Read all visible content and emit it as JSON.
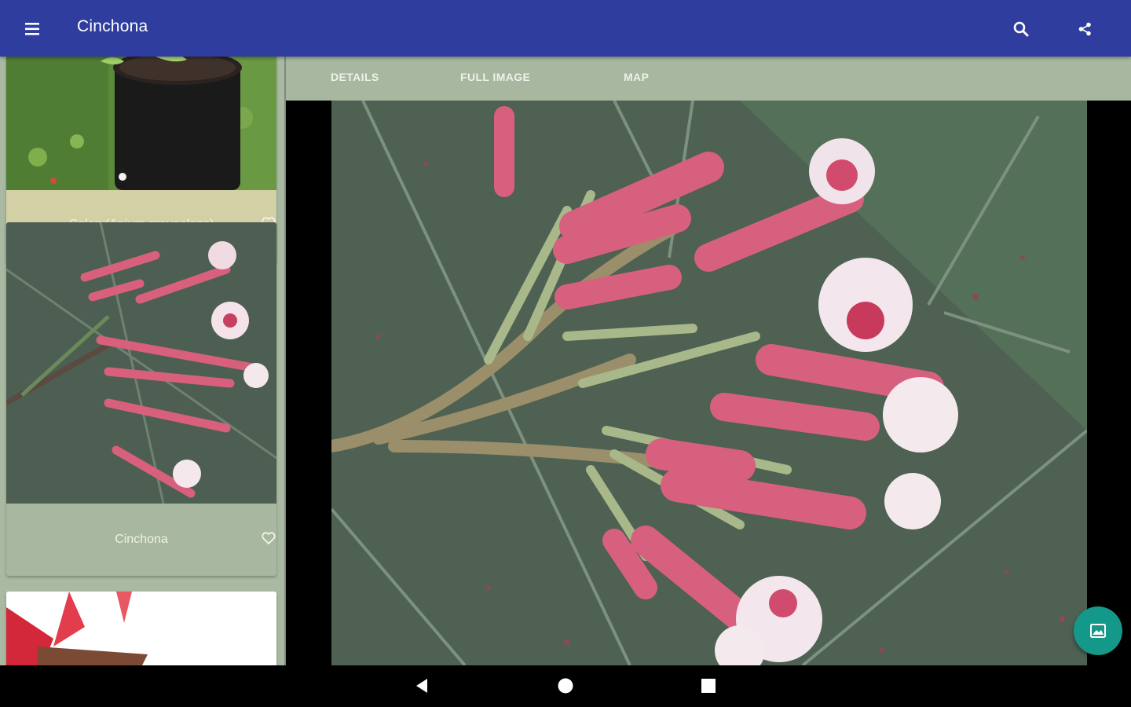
{
  "appbar": {
    "title": "Cinchona",
    "menu_icon": "hamburger-menu-icon",
    "search_icon": "search-icon",
    "share_icon": "share-icon",
    "color": "#2f3e9e"
  },
  "list": {
    "items": [
      {
        "label": "Celery(Apium graveolens)",
        "favorite_icon": "heart-outline-icon",
        "card_color": "#d3d0a5"
      },
      {
        "label": "Cinchona",
        "favorite_icon": "heart-outline-icon",
        "card_color": "#a7b7a0"
      },
      {
        "label": "",
        "card_color": "#ffffff"
      }
    ]
  },
  "tabs": [
    {
      "label": "DETAILS"
    },
    {
      "label": "FULL IMAGE"
    },
    {
      "label": "MAP"
    }
  ],
  "fab": {
    "icon": "image-icon",
    "color": "#139889"
  },
  "navbar": {
    "back_icon": "back-triangle-icon",
    "home_icon": "home-circle-icon",
    "recent_icon": "recent-apps-square-icon"
  }
}
